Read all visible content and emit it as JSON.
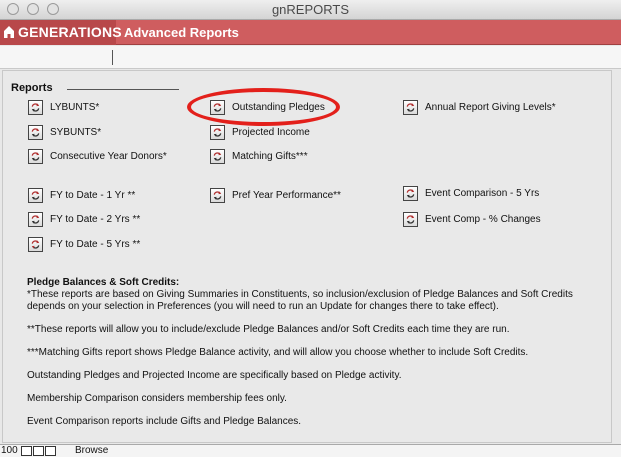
{
  "window": {
    "title": "gnREPORTS"
  },
  "brand": {
    "name": "GENERATIONS"
  },
  "breadcrumb": {
    "label": "Advanced Reports"
  },
  "reports": {
    "heading": "Reports",
    "items": [
      {
        "label": "LYBUNTS*"
      },
      {
        "label": "SYBUNTS*"
      },
      {
        "label": "Consecutive Year Donors*"
      },
      {
        "label": "FY to Date - 1 Yr **"
      },
      {
        "label": "FY to Date - 2 Yrs **"
      },
      {
        "label": "FY to Date - 5 Yrs **"
      },
      {
        "label": "Outstanding Pledges"
      },
      {
        "label": "Projected Income"
      },
      {
        "label": "Matching Gifts***"
      },
      {
        "label": "Pref Year Performance**"
      },
      {
        "label": "Annual Report Giving Levels*"
      },
      {
        "label": "Event Comparison - 5 Yrs"
      },
      {
        "label": "Event Comp - % Changes"
      }
    ]
  },
  "notes": {
    "title": "Pledge Balances & Soft Credits:",
    "p1": "*These reports are based on Giving Summaries in Constituents, so inclusion/exclusion of Pledge Balances and Soft Credits depends on your selection in Preferences (you will need to run an Update for changes there to take effect).",
    "p2": "**These reports will allow you to include/exclude Pledge Balances and/or Soft Credits each time they are run.",
    "p3": "***Matching Gifts report shows Pledge Balance activity, and will allow you choose whether to include Soft Credits.",
    "p4": "Outstanding Pledges and Projected Income are specifically based on Pledge activity.",
    "p5": "Membership Comparison considers membership fees only.",
    "p6": "Event Comparison reports include Gifts and Pledge Balances."
  },
  "status": {
    "zoom": "100",
    "mode": "Browse"
  },
  "colors": {
    "brand_bar": "#cf5d5f",
    "brand_block": "#b8484a",
    "highlight": "#e3201b"
  },
  "icons": {
    "report": "refresh-arrows-icon",
    "brand": "house-icon"
  }
}
